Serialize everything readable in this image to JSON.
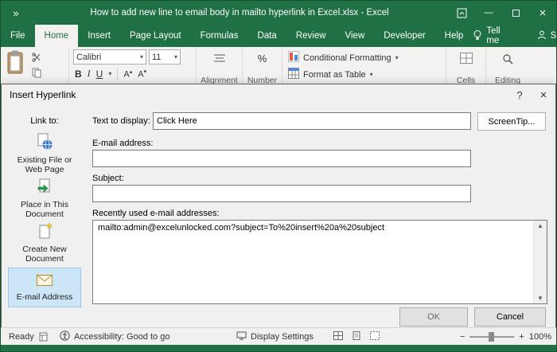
{
  "colors": {
    "titlebar_green": "#1f7044",
    "tab_active_bg": "#f3f2f1",
    "selected_item_bg": "#cde6f7"
  },
  "titlebar": {
    "overflow_chevrons": "»",
    "title": "How to add new line to email body in mailto hyperlink in Excel.xlsx - Excel"
  },
  "ribbon": {
    "tabs": [
      {
        "label": "File"
      },
      {
        "label": "Home"
      },
      {
        "label": "Insert"
      },
      {
        "label": "Page Layout"
      },
      {
        "label": "Formulas"
      },
      {
        "label": "Data"
      },
      {
        "label": "Review"
      },
      {
        "label": "View"
      },
      {
        "label": "Developer"
      },
      {
        "label": "Help"
      }
    ],
    "tell_me": "Tell me",
    "share": "Share",
    "font_name": "Calibri",
    "font_size": "11",
    "bold": "B",
    "italic": "I",
    "underline": "U",
    "grow_font": "A",
    "shrink_font": "A",
    "percent": "%",
    "conditional_formatting": "Conditional Formatting",
    "format_as_table": "Format as Table",
    "group_alignment": "Alignment",
    "group_number": "Number",
    "group_cells": "Cells",
    "group_editing": "Editing"
  },
  "dialog": {
    "title": "Insert Hyperlink",
    "link_to_label": "Link to:",
    "sidebar": [
      {
        "label": "Existing File or Web Page"
      },
      {
        "label": "Place in This Document"
      },
      {
        "label": "Create New Document"
      },
      {
        "label": "E-mail Address"
      }
    ],
    "text_to_display_label": "Text to display:",
    "text_to_display_value": "Click Here",
    "screentip_button": "ScreenTip...",
    "email_label": "E-mail address:",
    "email_value": "",
    "subject_label": "Subject:",
    "subject_value": "",
    "recent_label": "Recently used e-mail addresses:",
    "recent_items": [
      "mailto:admin@excelunlocked.com?subject=To%20insert%20a%20subject"
    ],
    "ok_button": "OK",
    "cancel_button": "Cancel"
  },
  "statusbar": {
    "ready": "Ready",
    "accessibility": "Accessibility: Good to go",
    "display_settings": "Display Settings",
    "zoom_level": "100%"
  },
  "icons": {
    "dropdown": "▾",
    "scroll_up": "▲",
    "scroll_down": "▼",
    "minus": "−",
    "plus": "+",
    "close": "×",
    "help": "?",
    "minimize": "—",
    "grow": "▴",
    "shrink": "▾"
  }
}
